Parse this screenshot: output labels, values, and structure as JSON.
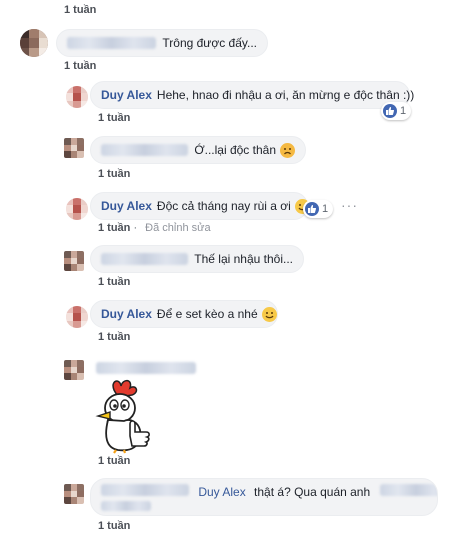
{
  "top_time": "1 tuần",
  "comments": [
    {
      "author": "",
      "text": "Trông được đấy...",
      "time": "1 tuần"
    },
    {
      "author": "Duy Alex",
      "text": "Hehe, hnao đi nhậu a ơi, ăn mừng e độc thân :))",
      "time": "1 tuần",
      "reaction_count": "1"
    },
    {
      "author": "",
      "text": "Ớ...lại độc thân",
      "time": "1 tuần"
    },
    {
      "author": "Duy Alex",
      "text": "Độc cả tháng nay rùi a ơi",
      "time": "1 tuần",
      "edited": "Đã chỉnh sửa",
      "reaction_count": "1"
    },
    {
      "author": "",
      "text": "Thế lại nhậu thôi...",
      "time": "1 tuần"
    },
    {
      "author": "Duy Alex",
      "text": "Để e set kèo a nhé",
      "time": "1 tuần"
    },
    {
      "author": "",
      "text": "",
      "time": "1 tuần",
      "sticker": "rooster-thumbs-up-sticker"
    },
    {
      "author": "",
      "mention": "Duy Alex",
      "text": "thật á? Qua quán anh",
      "time": "1 tuần"
    }
  ],
  "more_label": "···",
  "colors": {
    "link": "#365899",
    "bubble": "#f2f3f5",
    "like": "#4267b2"
  }
}
